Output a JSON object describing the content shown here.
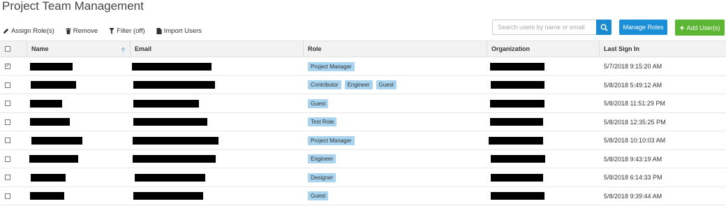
{
  "page": {
    "title": "Project Team Management"
  },
  "toolbar": {
    "assign_label": "Assign Role(s)",
    "remove_label": "Remove",
    "filter_label": "Filter (off)",
    "import_label": "Import Users"
  },
  "search": {
    "placeholder": "Search users by name or email",
    "value": ""
  },
  "buttons": {
    "manage_roles": "Manage Roles",
    "add_users": "Add User(s)"
  },
  "columns": {
    "name": "Name",
    "email": "Email",
    "role": "Role",
    "organization": "Organization",
    "last_sign_in": "Last Sign In"
  },
  "rows": [
    {
      "checked": true,
      "roles": [
        "Project Manager"
      ],
      "last_sign_in": "5/7/2018 9:15:20 AM"
    },
    {
      "checked": false,
      "roles": [
        "Contributor",
        "Engineer",
        "Guest"
      ],
      "last_sign_in": "5/8/2018 5:49:12 AM"
    },
    {
      "checked": false,
      "roles": [
        "Guest"
      ],
      "last_sign_in": "5/8/2018 11:51:29 PM"
    },
    {
      "checked": false,
      "roles": [
        "Test Role"
      ],
      "last_sign_in": "5/8/2018 12:35:25 PM"
    },
    {
      "checked": false,
      "roles": [
        "Project Manager"
      ],
      "last_sign_in": "5/8/2018 10:10:03 AM"
    },
    {
      "checked": false,
      "roles": [
        "Engineer"
      ],
      "last_sign_in": "5/8/2018 9:43:19 AM"
    },
    {
      "checked": false,
      "roles": [
        "Designer"
      ],
      "last_sign_in": "5/8/2018 6:14:33 PM"
    },
    {
      "checked": false,
      "roles": [
        "Guest"
      ],
      "last_sign_in": "5/8/2018 9:39:44 AM"
    }
  ],
  "colors": {
    "primary": "#1a8fd8",
    "success": "#5cb533",
    "tag_bg": "#a8d4f0",
    "header_bg": "#f2f2f2"
  },
  "icons": {
    "assign": "pencil-icon",
    "remove": "trash-icon",
    "filter": "funnel-icon",
    "import": "document-icon",
    "search": "search-icon",
    "sort": "sort-up-arrow-icon"
  }
}
